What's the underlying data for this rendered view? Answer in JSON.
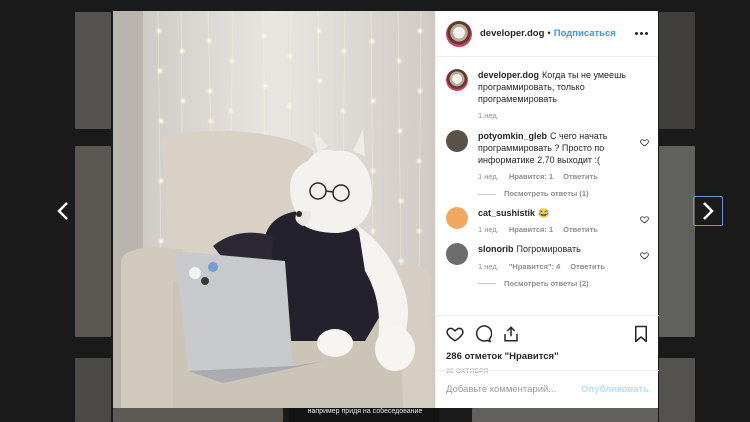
{
  "post": {
    "username": "developer.dog",
    "separator": "•",
    "follow_label": "Подписаться",
    "caption_user": "developer.dog",
    "caption_text": "Когда ты не умеешь программировать, только програмемировать",
    "caption_time": "1 нед.",
    "likes": "286 отметок \"Нравится\"",
    "date": "26 ОКТЯБРЯ",
    "comment_placeholder": "Добавьте комментарий...",
    "publish_label": "Опубликовать"
  },
  "comments": [
    {
      "user": "potyomkin_gleb",
      "text": "С чего начать программировать ? Просто по информатике 2.70 выходит :(",
      "time": "1 нед.",
      "likes": "Нравится: 1",
      "reply": "Ответить",
      "replies": "Посмотреть ответы (1)",
      "avatar_color": "#5a5148"
    },
    {
      "user": "cat_sushistik",
      "text": "😂",
      "time": "1 нед.",
      "likes": "Нравится: 1",
      "reply": "Ответить",
      "replies": "",
      "avatar_color": "#f0a860"
    },
    {
      "user": "slonorib",
      "text": "Погромировать",
      "time": "1 нед.",
      "likes": "\"Нравится\": 4",
      "reply": "Ответить",
      "replies": "Посмотреть ответы (2)",
      "avatar_color": "#6d6d6d"
    }
  ],
  "background": {
    "caption": "например придя на собеседование"
  },
  "icons": {
    "prev": "chevron-left-icon",
    "next": "chevron-right-icon",
    "like": "heart-icon",
    "comment": "comment-icon",
    "share": "share-icon",
    "save": "bookmark-icon",
    "more": "more-icon"
  },
  "colors": {
    "link": "#3897f0",
    "publish_disabled": "#b2dffc",
    "text": "#262626",
    "muted": "#8e8e8e"
  }
}
